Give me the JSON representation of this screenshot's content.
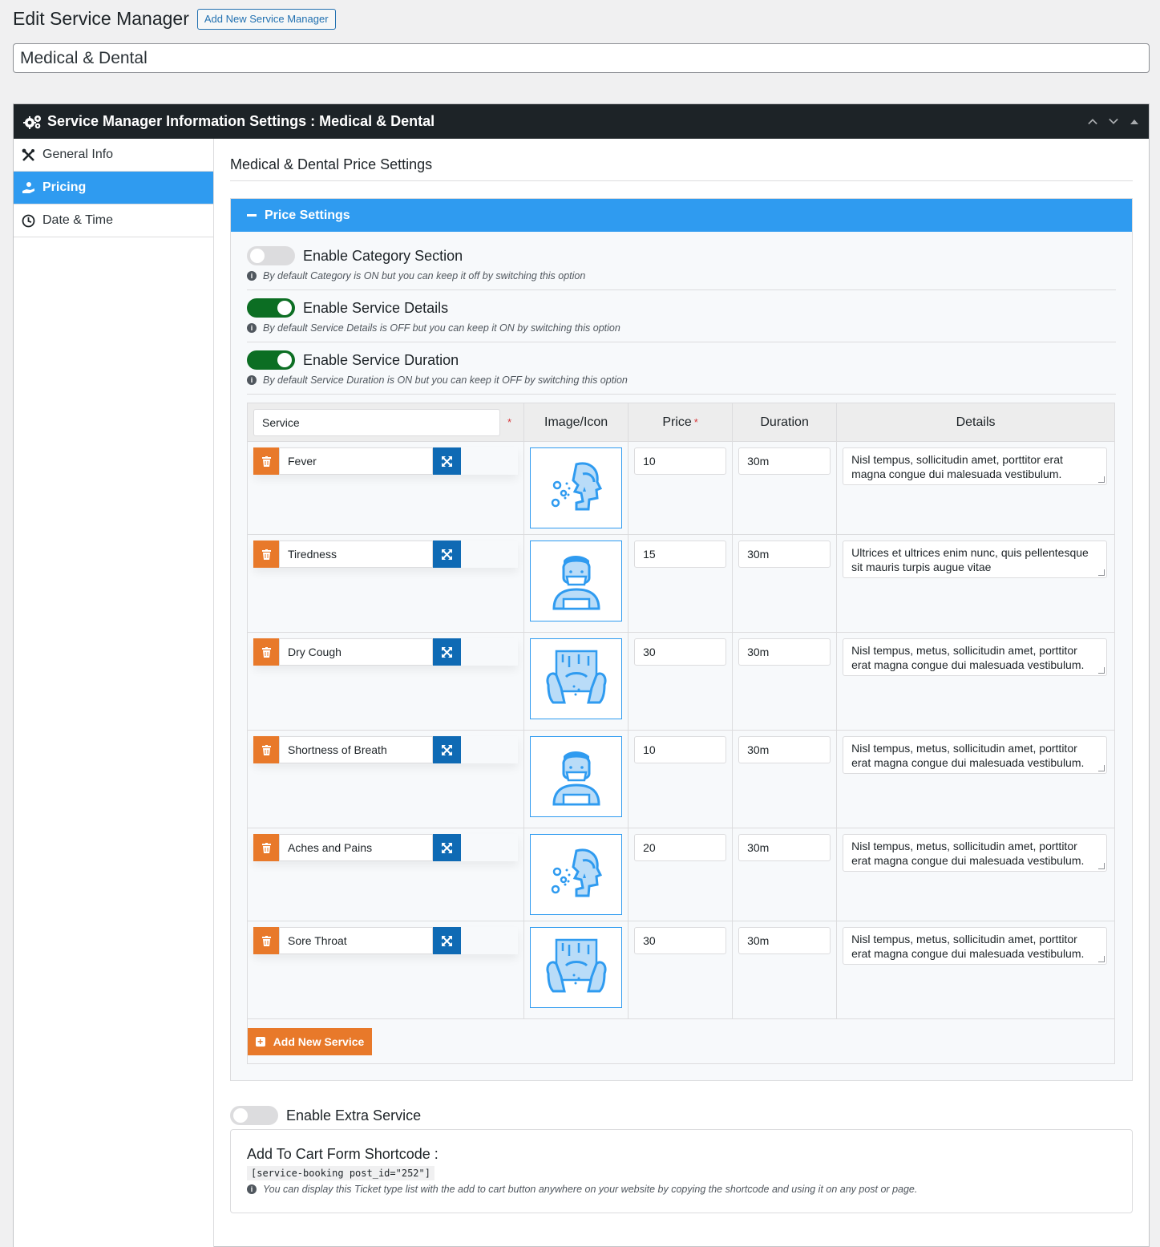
{
  "page": {
    "title": "Edit Service Manager",
    "add_new_label": "Add New Service Manager",
    "post_title": "Medical & Dental"
  },
  "metabox": {
    "title": "Service Manager Information Settings : Medical & Dental"
  },
  "sidebar": {
    "items": [
      {
        "label": "General Info",
        "icon": "tools-icon"
      },
      {
        "label": "Pricing",
        "icon": "hand-coin-icon",
        "active": true
      },
      {
        "label": "Date & Time",
        "icon": "clock-icon"
      }
    ]
  },
  "main": {
    "heading": "Medical & Dental Price Settings",
    "panel_title": "Price Settings",
    "options": [
      {
        "label": "Enable Category Section",
        "hint": "By default Category is ON but you can keep it off by switching this option",
        "on": false
      },
      {
        "label": "Enable Service Details",
        "hint": "By default Service Details is OFF but you can keep it ON by switching this option",
        "on": true
      },
      {
        "label": "Enable Service Duration",
        "hint": "By default Service Duration is ON but you can keep it OFF by switching this option",
        "on": true
      }
    ],
    "table": {
      "service_placeholder": "Service",
      "headers": {
        "image": "Image/Icon",
        "price": "Price",
        "duration": "Duration",
        "details": "Details"
      },
      "required_mark": "*",
      "rows": [
        {
          "name": "Fever",
          "icon": "sneeze-icon",
          "price": "10",
          "duration": "30m",
          "details": "Nisl tempus, sollicitudin amet, porttitor erat magna congue dui malesuada vestibulum."
        },
        {
          "name": "Tiredness",
          "icon": "masked-person-icon",
          "price": "15",
          "duration": "30m",
          "details": "Ultrices et ultrices enim nunc, quis pellentesque sit mauris turpis augue vitae"
        },
        {
          "name": "Dry Cough",
          "icon": "cough-hands-icon",
          "price": "30",
          "duration": "30m",
          "details": "Nisl tempus, metus, sollicitudin amet, porttitor erat magna congue dui malesuada vestibulum."
        },
        {
          "name": "Shortness of Breath",
          "icon": "masked-person-icon",
          "price": "10",
          "duration": "30m",
          "details": "Nisl tempus, metus, sollicitudin amet, porttitor erat magna congue dui malesuada vestibulum."
        },
        {
          "name": "Aches and Pains",
          "icon": "sneeze-icon",
          "price": "20",
          "duration": "30m",
          "details": "Nisl tempus, metus, sollicitudin amet, porttitor erat magna congue dui malesuada vestibulum."
        },
        {
          "name": "Sore Throat",
          "icon": "cough-hands-icon",
          "price": "30",
          "duration": "30m",
          "details": "Nisl tempus, metus, sollicitudin amet, porttitor erat magna congue dui malesuada vestibulum."
        }
      ]
    },
    "add_service_label": "Add New Service",
    "extra_service_label": "Enable Extra Service",
    "shortcode": {
      "title": "Add To Cart Form Shortcode :",
      "code": "[service-booking post_id=\"252\"]",
      "hint": "You can display this Ticket type list with the add to cart button anywhere on your website by copying the shortcode and using it on any post or page."
    }
  },
  "colors": {
    "accent_blue": "#2f9bf0",
    "toggle_on": "#0c6e23",
    "delete_orange": "#e8792a",
    "expand_blue": "#0f6ab4",
    "header_dark": "#1d2327"
  }
}
